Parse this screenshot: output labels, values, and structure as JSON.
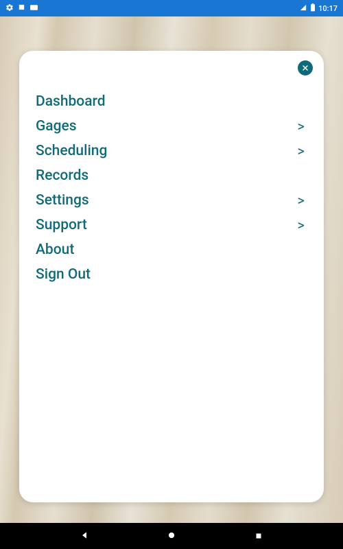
{
  "statusbar": {
    "time": "10:17"
  },
  "menu": {
    "items": [
      {
        "label": "Dashboard",
        "has_sub": false
      },
      {
        "label": "Gages",
        "has_sub": true
      },
      {
        "label": "Scheduling",
        "has_sub": true
      },
      {
        "label": "Records",
        "has_sub": false
      },
      {
        "label": "Settings",
        "has_sub": true
      },
      {
        "label": "Support",
        "has_sub": true
      },
      {
        "label": "About",
        "has_sub": false
      },
      {
        "label": "Sign Out",
        "has_sub": false
      }
    ]
  },
  "colors": {
    "accent": "#0f6b7a",
    "statusbar_bg": "#1976d2"
  }
}
